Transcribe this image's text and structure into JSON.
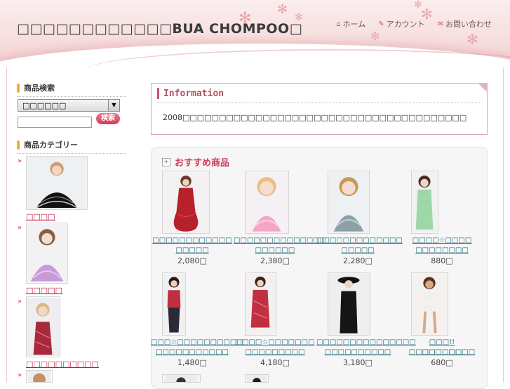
{
  "header": {
    "site_title": "BUA CHOMPOO",
    "nav": [
      {
        "label": "ホーム",
        "icon": "home-icon"
      },
      {
        "label": "アカウント",
        "icon": "edit-icon"
      },
      {
        "label": "お問い合わせ",
        "icon": "mail-icon"
      }
    ]
  },
  "sidebar": {
    "search_heading": "商品検索",
    "select_value": "",
    "search_button": "検索",
    "category_heading": "商品カテゴリー",
    "categories": [
      {
        "label": ""
      },
      {
        "label": ""
      },
      {
        "label": ""
      }
    ]
  },
  "info": {
    "title": "Information",
    "text": "2008"
  },
  "recommended": {
    "title": "おすすめ商品",
    "products": [
      {
        "name_line1": "",
        "name_line2": "",
        "price": "2,080"
      },
      {
        "name_line1": "",
        "name_line2": "",
        "price": "2,380"
      },
      {
        "name_line1": "",
        "name_line2": "",
        "price": "2,280"
      },
      {
        "name_line1": "☆",
        "name_line2": "",
        "price": "880"
      },
      {
        "name_line1": "☆",
        "name_line2": "",
        "price": "1,480"
      },
      {
        "name_line1": "☆",
        "name_line2": "",
        "price": "4,180"
      },
      {
        "name_line1": "",
        "name_line2": "",
        "price": "3,180"
      },
      {
        "name_line1": "!!",
        "name_line2": "",
        "price": "680"
      }
    ]
  },
  "colors": {
    "accent_pink": "#d23a5c",
    "link_teal": "#1e6f7e",
    "category_red": "#c0183c",
    "heading_bar": "#f0b030"
  }
}
